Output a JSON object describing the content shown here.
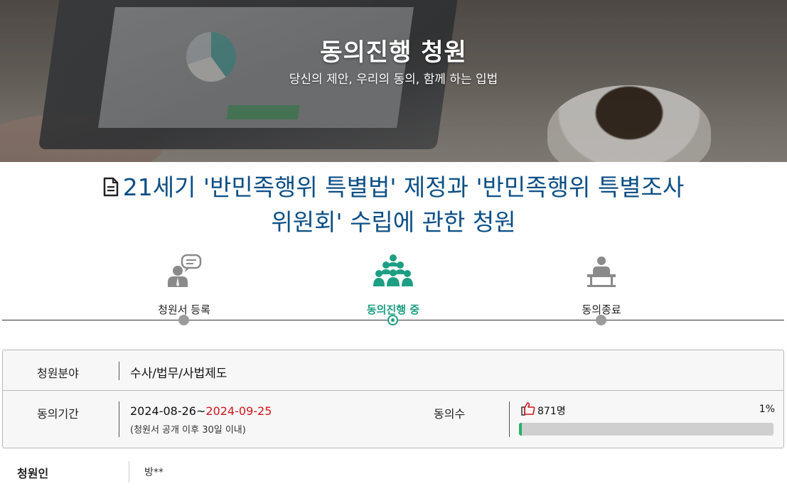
{
  "hero": {
    "title": "동의진행 청원",
    "subtitle": "당신의 제안, 우리의 동의, 함께 하는 입법"
  },
  "petition": {
    "title_line1": "21세기 '반민족행위 특별법' 제정과 '반민족행위 특별조사",
    "title_line2": "위원회' 수립에 관한 청원",
    "title_icon": "document-icon"
  },
  "steps": [
    {
      "label": "청원서 등록",
      "icon": "registration-icon",
      "active": false
    },
    {
      "label": "동의진행 중",
      "icon": "group-consent-icon",
      "active": true
    },
    {
      "label": "동의종료",
      "icon": "podium-speaker-icon",
      "active": false
    }
  ],
  "info": {
    "field_label": "청원분야",
    "field_value": "수사/법무/사법제도",
    "period_label": "동의기간",
    "period_start": "2024-08-26~",
    "period_end": "2024-09-25",
    "period_note": "(청원서 공개 이후 30일 이내)",
    "count_label": "동의수",
    "count_value": "871명",
    "count_icon": "thumbs-up-icon",
    "progress_percent_label": "1%",
    "progress_fraction": 0.01
  },
  "petitioner": {
    "label": "청원인",
    "value": "방**"
  },
  "colors": {
    "title_blue": "#0d4f86",
    "accent_green": "#1e9e83",
    "progress_green": "#23b266",
    "deadline_red": "#d0161c"
  }
}
